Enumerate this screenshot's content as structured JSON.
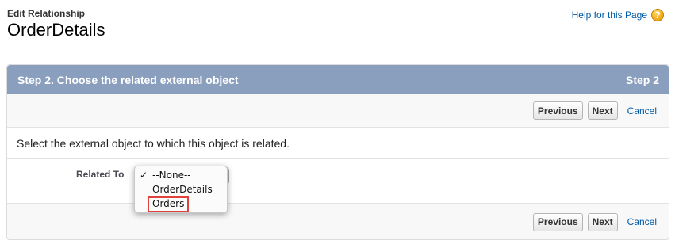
{
  "header": {
    "label": "Edit Relationship",
    "title": "OrderDetails",
    "help_link": "Help for this Page",
    "help_icon": "question-icon"
  },
  "panel": {
    "step_title": "Step 2. Choose the related external object",
    "step_number": "Step 2",
    "previous_label": "Previous",
    "next_label": "Next",
    "cancel_label": "Cancel",
    "instruction": "Select the external object to which this object is related.",
    "field_label": "Related To"
  },
  "select": {
    "options": [
      "--None--",
      "OrderDetails",
      "Orders"
    ],
    "checked": "--None--",
    "highlighted": "Orders"
  },
  "colors": {
    "header_bar": "#8a9ebe",
    "link": "#015ba7",
    "highlight": "#e0413a"
  }
}
